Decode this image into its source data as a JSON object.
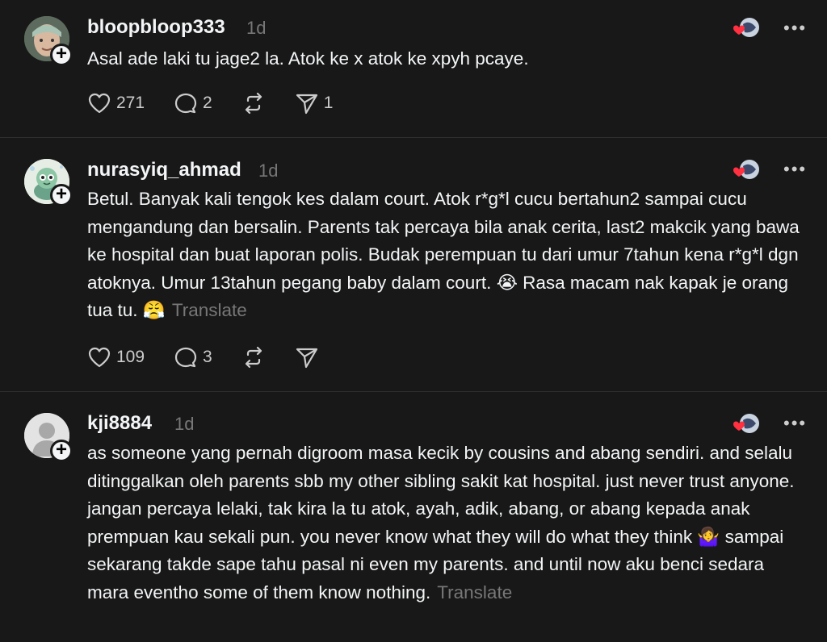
{
  "posts": [
    {
      "username": "bloopbloop333",
      "time": "1d",
      "text": "Asal ade laki tu jage2 la. Atok ke x atok ke xpyh pcaye.",
      "translate": "",
      "likes": "271",
      "replies": "2",
      "reposts": "",
      "shares": "1",
      "avatar_icon": "person-photo-avatar"
    },
    {
      "username": "nurasyiq_ahmad",
      "time": "1d",
      "text": "Betul. Banyak kali tengok kes dalam court. Atok r*g*l cucu bertahun2 sampai cucu mengandung dan bersalin. Parents tak percaya bila anak cerita, last2 makcik yang bawa ke hospital dan buat laporan polis. Budak perempuan tu dari umur 7tahun kena r*g*l dgn atoknya. Umur 13tahun pegang baby dalam court. 😭 Rasa macam nak kapak je orang tua tu. 😤",
      "translate": "Translate",
      "likes": "109",
      "replies": "3",
      "reposts": "",
      "shares": "",
      "avatar_icon": "turtle-cartoon-avatar"
    },
    {
      "username": "kji8884",
      "time": "1d",
      "text": "as someone yang pernah digroom masa kecik by cousins and abang sendiri. and selalu ditinggalkan oleh parents sbb my other sibling sakit kat hospital. just never trust anyone. jangan percaya lelaki, tak kira la tu atok, ayah, adik, abang, or abang kepada anak prempuan kau sekali pun. you never know what they will do what they think 🤷‍♀️ sampai sekarang takde sape tahu pasal ni even my parents. and until now aku benci sedara mara eventho some of them know nothing.",
      "translate": "Translate",
      "likes": "",
      "replies": "",
      "reposts": "",
      "shares": "",
      "avatar_icon": "default-person-avatar"
    }
  ],
  "more_label": "•••",
  "colors": {
    "background": "#181818",
    "text": "#f3f5f7",
    "secondary": "#777777",
    "heart": "#ff3040"
  }
}
